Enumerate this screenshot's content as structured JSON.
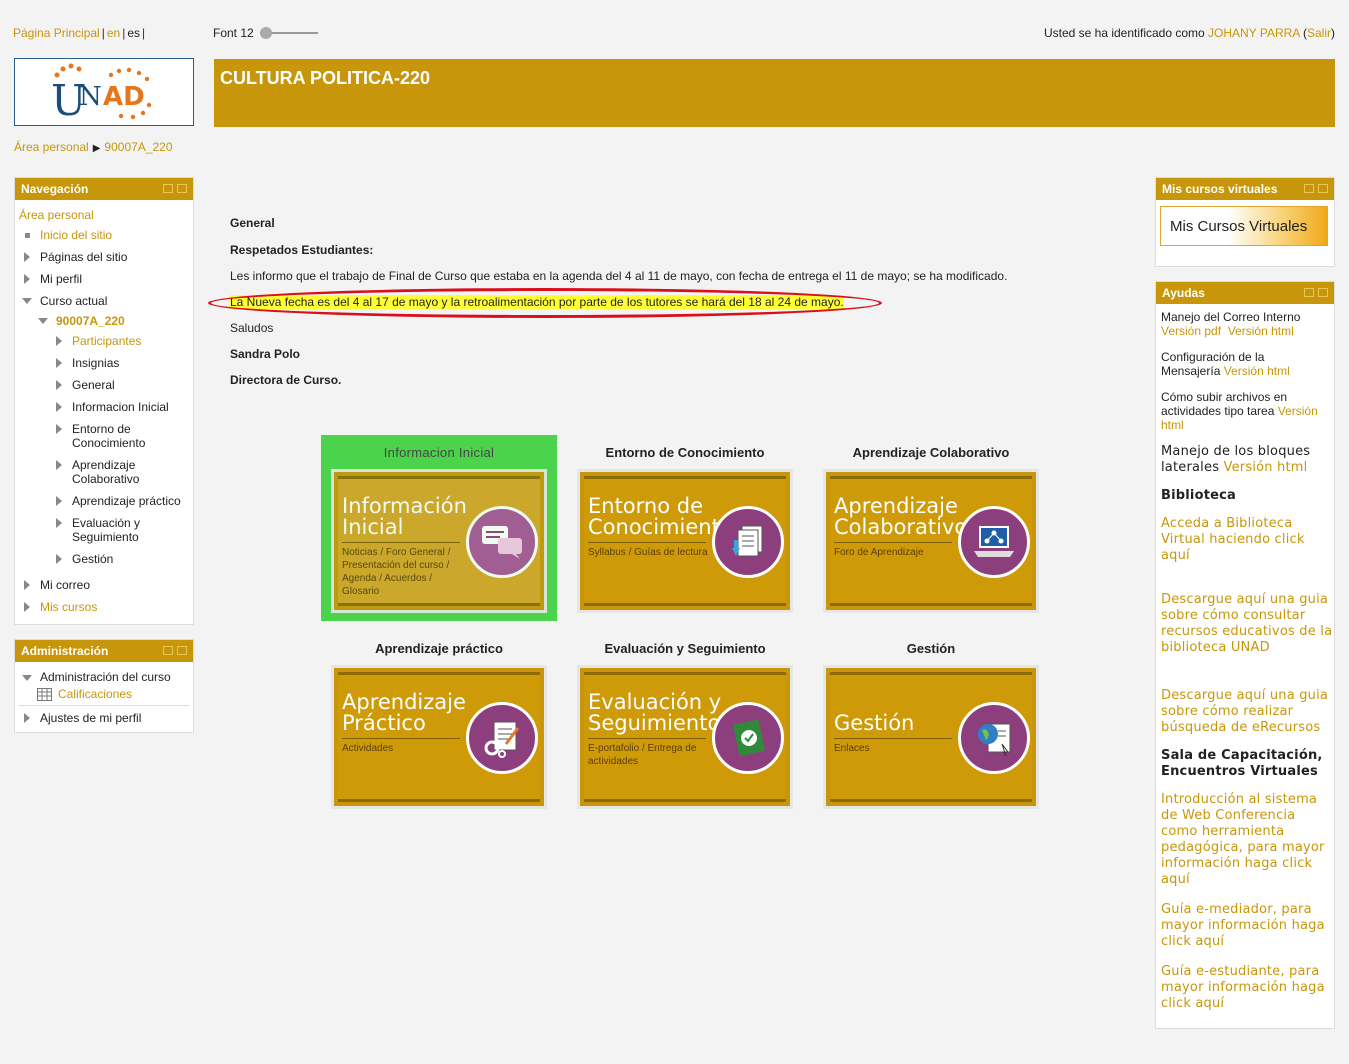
{
  "topbar": {
    "home_link": "Página Principal",
    "lang_en": "en",
    "lang_es": "es",
    "font_label": "Font 12",
    "login_prefix": "Usted se ha identificado como ",
    "user_name": "JOHANY PARRA",
    "logout_link": "Salir"
  },
  "logo": {
    "text_u": "U",
    "text_n": "N",
    "text_ad": "AD"
  },
  "header": {
    "title": "CULTURA POLITICA-220"
  },
  "breadcrumb": {
    "item1": "Área personal",
    "item2": "90007A_220"
  },
  "navigation": {
    "title": "Navegación",
    "items": [
      "Área personal",
      "Inicio del sitio",
      "Páginas del sitio",
      "Mi perfil",
      "Curso actual",
      "90007A_220",
      "Participantes",
      "Insignias",
      "General",
      "Informacion Inicial",
      "Entorno de Conocimiento",
      "Aprendizaje Colaborativo",
      "Aprendizaje práctico",
      "Evaluación y Seguimiento",
      "Gestión",
      "Mi correo",
      "Mis cursos"
    ]
  },
  "administration": {
    "title": "Administración",
    "course_admin": "Administración del curso",
    "grades": "Calificaciones",
    "profile_settings": "Ajustes de mi perfil"
  },
  "content": {
    "section": "General",
    "greeting": "Respetados Estudiantes:",
    "para1": "Les informo que el trabajo de Final de Curso  que estaba en la agenda del 4 al 11 de mayo, con fecha de entrega el 11 de mayo; se ha modificado.",
    "para2": "La Nueva fecha es del 4 al 17 de mayo y la retroalimentación por parte de los tutores se hará del 18 al 24 de mayo.",
    "closing": "Saludos",
    "signer": "Sandra Polo",
    "signer_role": "Directora de Curso."
  },
  "tiles": [
    {
      "title": "Informacion Inicial",
      "big1": "Información",
      "big2": "Inicial",
      "small": "Noticias / Foro General / Presentación del curso / Agenda / Acuerdos / Glosario",
      "icon": "chat-bubbles-icon"
    },
    {
      "title": "Entorno de Conocimiento",
      "big1": "Entorno de",
      "big2": "Conocimiento",
      "small": "Syllabus / Guías de lectura",
      "icon": "documents-download-icon"
    },
    {
      "title": "Aprendizaje Colaborativo",
      "big1": "Aprendizaje",
      "big2": "Colaborativo",
      "small": "Foro de Aprendizaje",
      "icon": "laptop-network-icon"
    },
    {
      "title": "Aprendizaje práctico",
      "big1": "Aprendizaje",
      "big2": "Práctico",
      "small": "Actividades",
      "icon": "document-gears-icon"
    },
    {
      "title": "Evaluación y Seguimiento",
      "big1": "Evaluación y",
      "big2": "Seguimiento",
      "small": "E-portafolio / Entrega de actividades",
      "icon": "notebook-check-icon"
    },
    {
      "title": "Gestión",
      "big1": "Gestión",
      "big2": "",
      "small": "Enlaces",
      "icon": "globe-document-icon"
    }
  ],
  "mis_cursos": {
    "title": "Mis cursos virtuales",
    "banner": "Mis Cursos Virtuales"
  },
  "ayudas": {
    "title": "Ayudas",
    "h1_text": "Manejo del Correo Interno",
    "h1_pdf": "Versión pdf",
    "h1_html": "Versión html",
    "h2_text": "Configuración de la Mensajería",
    "h2_html": "Versión html",
    "h3_text": "Cómo subir archivos en actividades tipo tarea",
    "h3_html": "Versión html",
    "h4_text": "Manejo de los bloques laterales",
    "h4_html": "Versión html",
    "biblioteca": "Biblioteca",
    "lib1": "Acceda a Biblioteca Virtual haciendo click aquí",
    "lib2": "Descargue aquí una guia sobre cómo consultar recursos educativos de la biblioteca UNAD",
    "lib3": "Descargue aquí una guia sobre cómo realizar búsqueda de eRecursos",
    "sala": "Sala de Capacitación, Encuentros Virtuales",
    "sala1": "Introducción al sistema de Web Conferencia como herramienta pedagógica, para mayor información haga click aquí",
    "sala2": "Guía e-mediador, para mayor información haga click aquí",
    "sala3": "Guía e-estudiante, para mayor información haga click aquí"
  },
  "colors": {
    "accent": "#c8960a",
    "highlight": "#ffff33",
    "circle": "#8d3f7d",
    "selected_tile": "#4cd34c",
    "ellipse": "#d9101a"
  }
}
